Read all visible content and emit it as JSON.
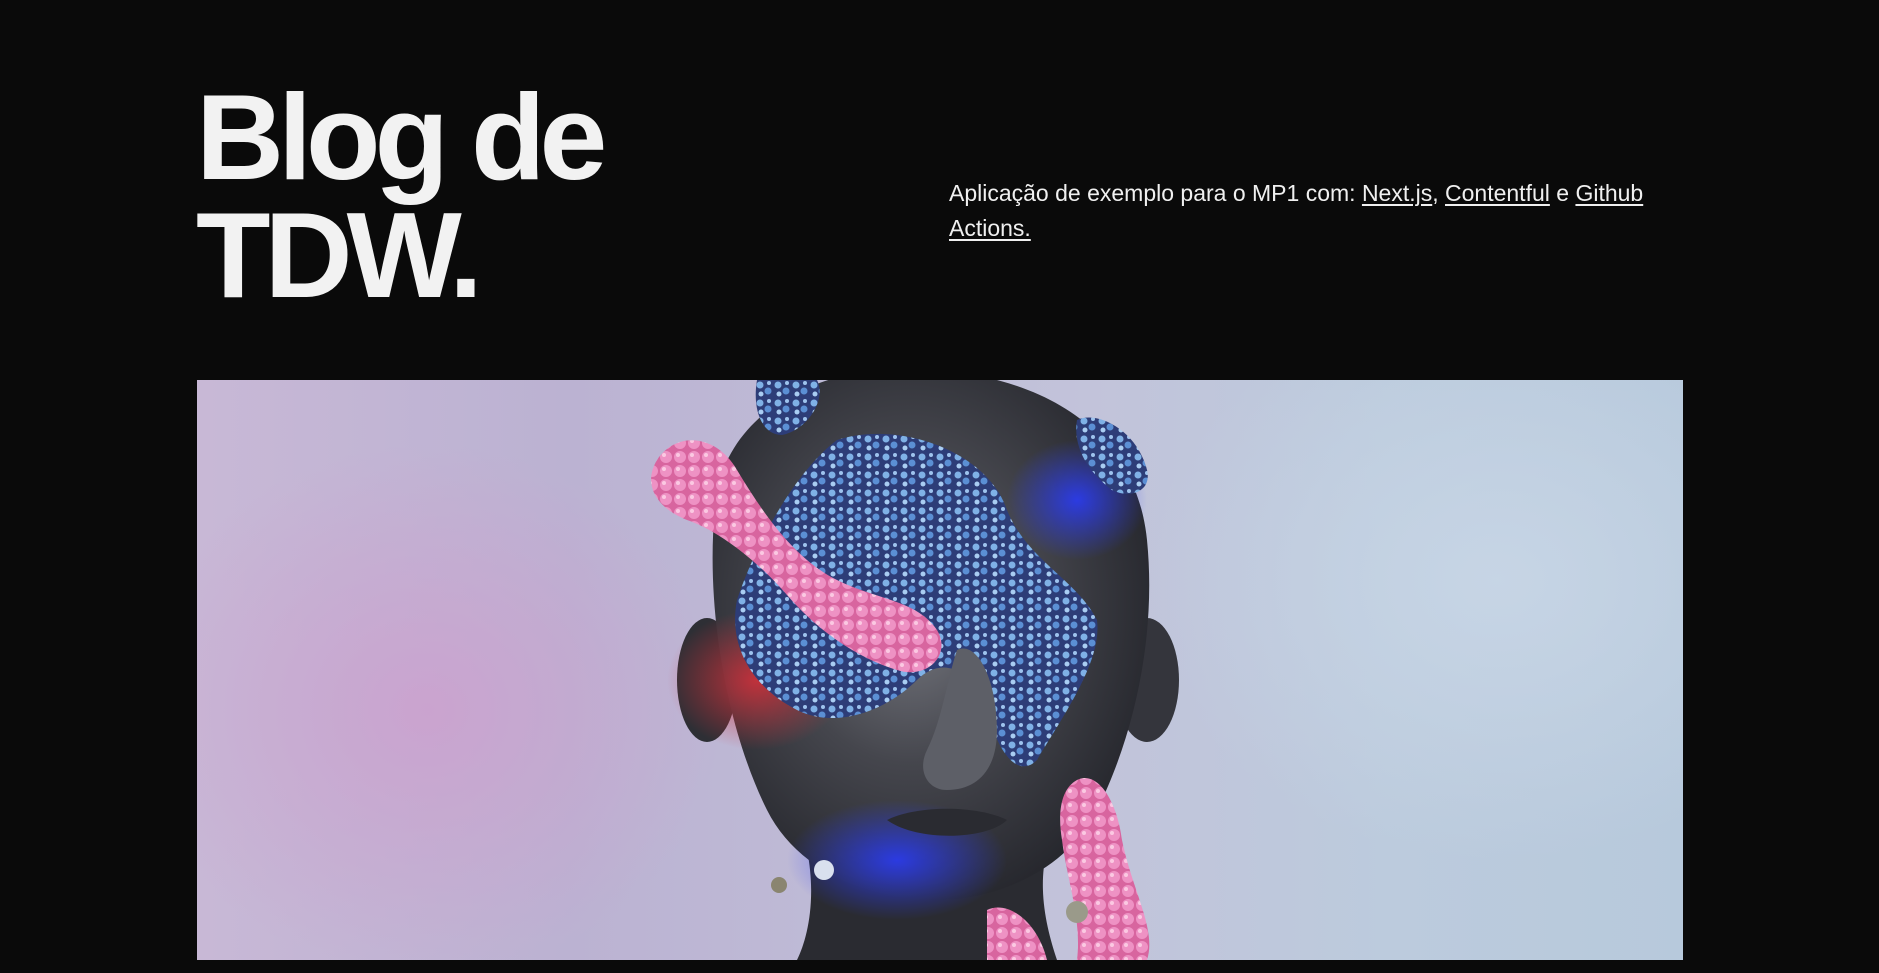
{
  "header": {
    "title_line1": "Blog de",
    "title_line2": "TDW."
  },
  "intro": {
    "prefix": "Aplicação de exemplo para o MP1 com: ",
    "links": [
      {
        "label": "Next.js"
      },
      {
        "label": "Contentful"
      },
      {
        "label": "Github Actions."
      }
    ],
    "separator1": ", ",
    "separator2": " e "
  },
  "cover_image": {
    "icon": "sculpture-head-image",
    "colors": {
      "background_left": "#c8b8d6",
      "background_right": "#b7c9dc",
      "head": "#3e3f45",
      "flowers_pink": "#e07ab4",
      "flowers_blue": "#6aa2dc"
    }
  }
}
